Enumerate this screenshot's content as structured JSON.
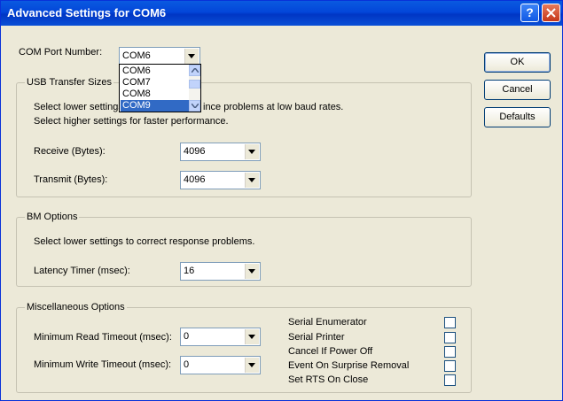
{
  "window": {
    "title": "Advanced Settings for COM6",
    "help_label": "?"
  },
  "com_port": {
    "label": "COM Port Number:",
    "value": "COM6",
    "options": [
      "COM6",
      "COM7",
      "COM8",
      "COM9"
    ],
    "highlighted": "COM9"
  },
  "usb": {
    "legend": "USB Transfer Sizes",
    "desc_line1_left": "Select lower settings",
    "desc_line1_right": "ince problems at low baud rates.",
    "desc_line2": "Select higher settings for faster performance.",
    "receive_label": "Receive (Bytes):",
    "receive_value": "4096",
    "transmit_label": "Transmit (Bytes):",
    "transmit_value": "4096"
  },
  "bm": {
    "legend": "BM Options",
    "desc": "Select lower settings to correct response problems.",
    "latency_label": "Latency Timer (msec):",
    "latency_value": "16"
  },
  "misc": {
    "legend": "Miscellaneous Options",
    "min_read_label": "Minimum Read Timeout (msec):",
    "min_read_value": "0",
    "min_write_label": "Minimum Write Timeout (msec):",
    "min_write_value": "0",
    "checkboxes": [
      {
        "label": "Serial Enumerator",
        "checked": false
      },
      {
        "label": "Serial Printer",
        "checked": false
      },
      {
        "label": "Cancel If Power Off",
        "checked": false
      },
      {
        "label": "Event On Surprise Removal",
        "checked": false
      },
      {
        "label": "Set RTS On Close",
        "checked": false
      }
    ]
  },
  "buttons": {
    "ok": "OK",
    "cancel": "Cancel",
    "defaults": "Defaults"
  },
  "colors": {
    "titlebar": "#0a5ae0",
    "face": "#ece9d8",
    "selection": "#316ac5",
    "close": "#c6371a"
  }
}
